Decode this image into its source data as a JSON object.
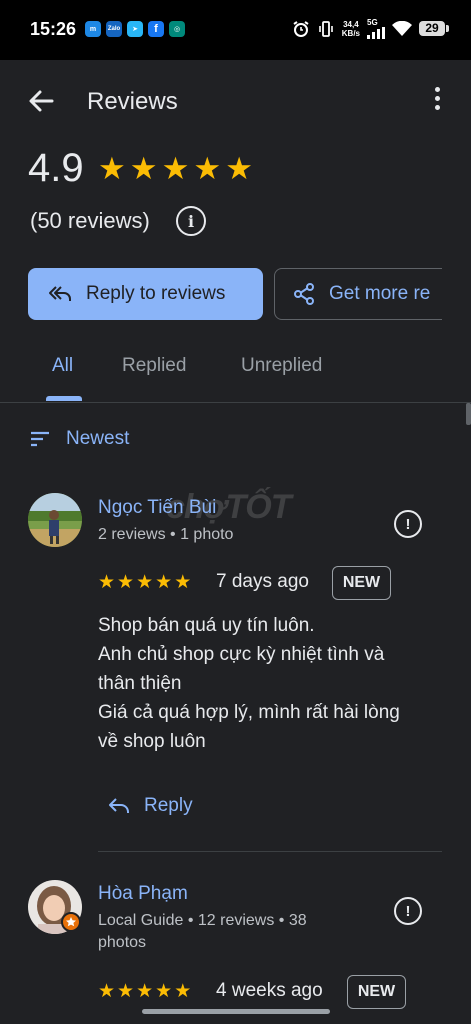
{
  "status_bar": {
    "time": "15:26",
    "apps": [
      {
        "name": "messenger-icon",
        "label": "m",
        "color": "#1e88e5"
      },
      {
        "name": "zalo-icon",
        "label": "Zalo",
        "color": "#1565c0"
      },
      {
        "name": "telegram-icon",
        "label": "➤",
        "color": "#29b6f6"
      },
      {
        "name": "facebook-icon",
        "label": "f",
        "color": "#1877f2"
      },
      {
        "name": "app-icon",
        "label": "◎",
        "color": "#00897b"
      }
    ],
    "net_speed_value": "34,4",
    "net_speed_unit": "KB/s",
    "signal_label": "5G",
    "battery": "29"
  },
  "header": {
    "title": "Reviews"
  },
  "summary": {
    "rating": "4.9",
    "reviews_count": "(50 reviews)",
    "stars": 5
  },
  "actions": {
    "reply_label": "Reply to reviews",
    "get_more_label": "Get more re"
  },
  "tabs": [
    {
      "label": "All",
      "active": true
    },
    {
      "label": "Replied",
      "active": false
    },
    {
      "label": "Unreplied",
      "active": false
    }
  ],
  "sort": {
    "label": "Newest"
  },
  "watermark": "chợTỐT",
  "reviews": [
    {
      "name": "Ngọc Tiến Bùi",
      "meta": "2 reviews • 1 photo",
      "stars": 5,
      "date": "7 days ago",
      "badge": "NEW",
      "text_lines": [
        "Shop bán quá uy tín luôn.",
        "Anh chủ shop cực kỳ nhiệt tình và",
        "thân thiện",
        "Giá cả quá hợp lý, mình rất hài lòng",
        "về shop luôn"
      ],
      "reply_label": "Reply"
    },
    {
      "name": "Hòa Phạm",
      "meta": "Local Guide • 12 reviews • 38 photos",
      "stars": 5,
      "date": "4 weeks ago",
      "badge": "NEW"
    }
  ],
  "colors": {
    "background": "#202124",
    "accent": "#8ab4f8",
    "star": "#fbbc04"
  }
}
